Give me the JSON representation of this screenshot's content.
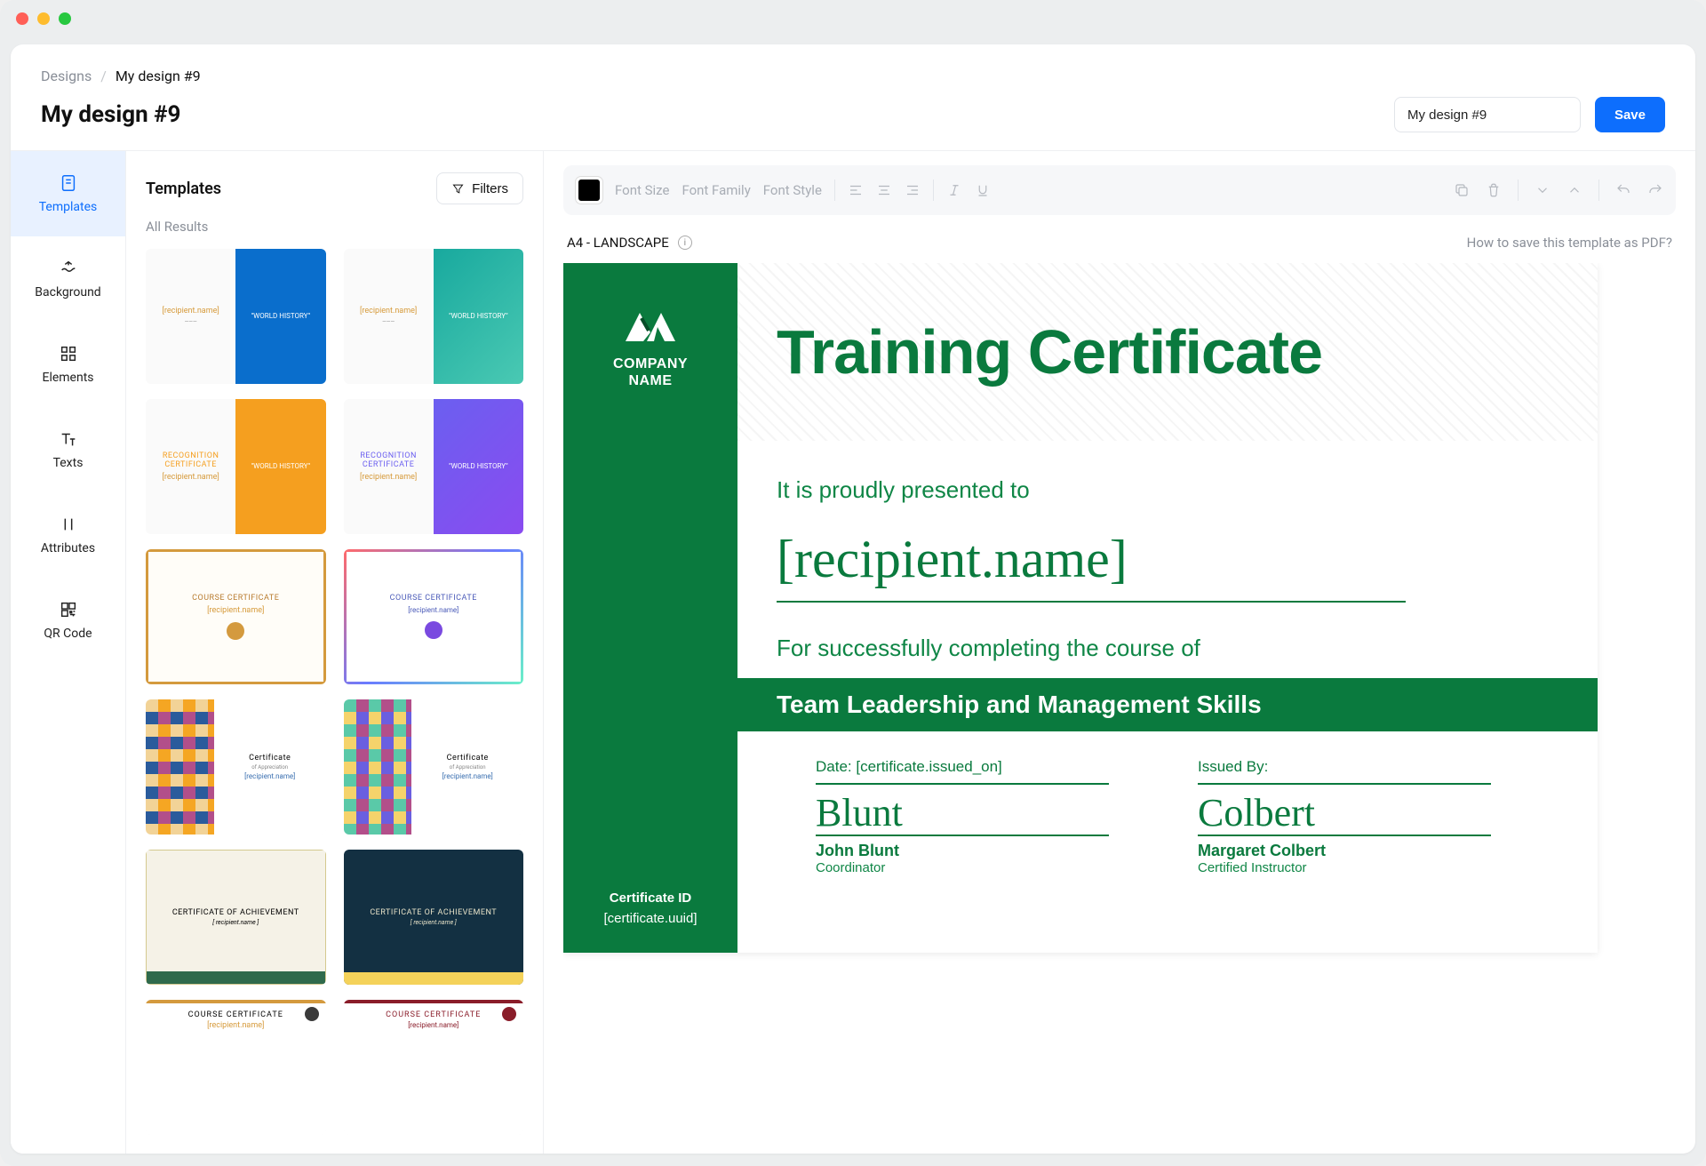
{
  "breadcrumbs": {
    "root": "Designs",
    "current": "My design #9"
  },
  "page_title": "My design #9",
  "header": {
    "name_value": "My design #9",
    "save_label": "Save"
  },
  "sidebar": {
    "items": [
      {
        "label": "Templates"
      },
      {
        "label": "Background"
      },
      {
        "label": "Elements"
      },
      {
        "label": "Texts"
      },
      {
        "label": "Attributes"
      },
      {
        "label": "QR Code"
      }
    ]
  },
  "templates_panel": {
    "title": "Templates",
    "filters_label": "Filters",
    "subtitle": "All Results",
    "thumbnails": {
      "world_history": "\"WORLD HISTORY\"",
      "recipient_name": "[recipient.name]",
      "recognition_title": "RECOGNITION CERTIFICATE",
      "course_title": "COURSE CERTIFICATE",
      "certificate_label": "Certificate",
      "of_appreciation": "of Appreciation",
      "achievement_title": "CERTIFICATE OF ACHIEVEMENT",
      "recipient_italic": "[ recipient.name ]"
    }
  },
  "toolbar": {
    "font_size": "Font Size",
    "font_family": "Font Family",
    "font_style": "Font Style"
  },
  "canvas": {
    "meta": "A4 - LANDSCAPE",
    "help": "How to save this template as PDF?"
  },
  "certificate": {
    "company_line1": "COMPANY",
    "company_line2": "NAME",
    "id_label": "Certificate ID",
    "id_value": "[certificate.uuid]",
    "title": "Training Certificate",
    "presented_to": "It is proudly presented to",
    "recipient": "[recipient.name]",
    "completing": "For successfully completing the course of",
    "course": "Team Leadership and Management Skills",
    "date_label": "Date: [certificate.issued_on]",
    "issued_label": "Issued By:",
    "sig1": "Blunt",
    "signer1_name": "John Blunt",
    "signer1_role": "Coordinator",
    "sig2": "Colbert",
    "signer2_name": "Margaret Colbert",
    "signer2_role": "Certified Instructor"
  }
}
